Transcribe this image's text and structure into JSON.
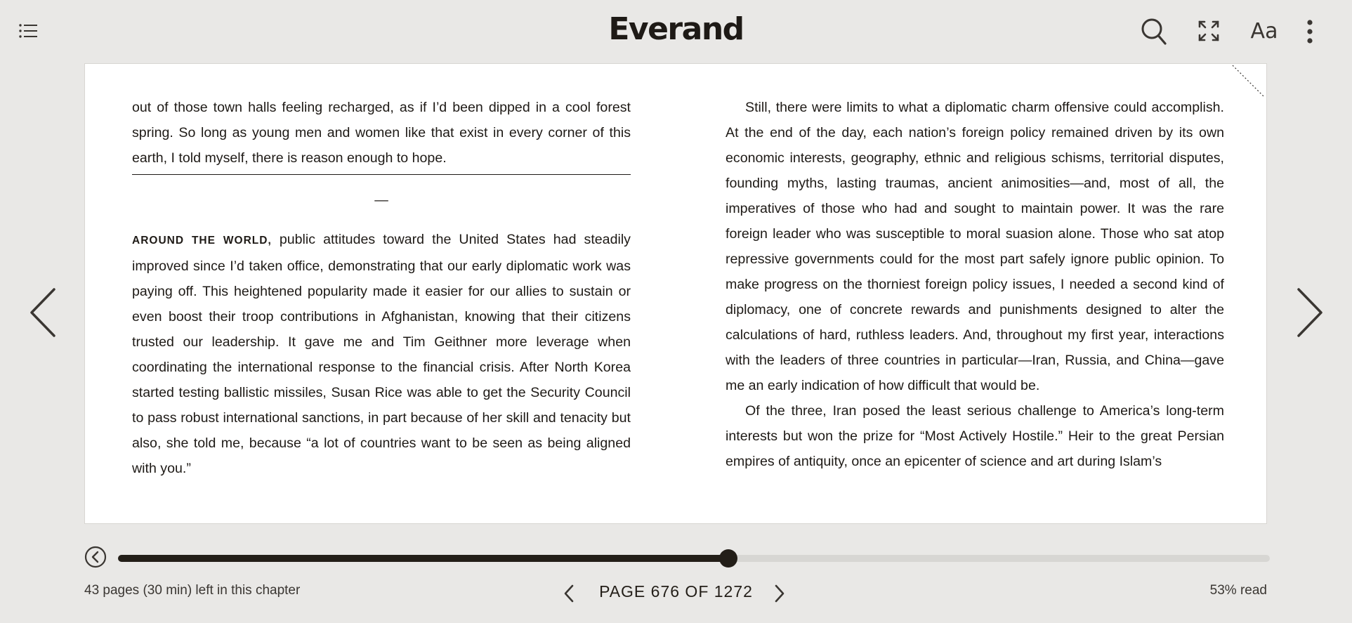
{
  "app": {
    "brand": "Everand"
  },
  "toolbar": {
    "icons": [
      "list-icon",
      "search-icon",
      "fullscreen-icon",
      "font-settings-icon",
      "more-vertical-icon"
    ],
    "font_settings_label": "Aa"
  },
  "left_page": {
    "para1": "out of those town halls feeling recharged, as if I’d been dipped in a cool forest spring. So long as young men and women like that exist in every corner of this earth, I told myself, there is reason enough to hope.",
    "separator": "—",
    "para2_lead": "AROUND THE WORLD,",
    "para2_body": " public attitudes toward the United States had steadily improved since I’d taken office, demonstrating that our early diplomatic work was paying off. This heightened popularity made it easier for our allies to sustain or even boost their troop contributions in Afghanistan, knowing that their citizens trusted our leadership. It gave me and Tim Geithner more leverage when coordinating the international response to the financial crisis. After North Korea started testing ballistic missiles, Susan Rice was able to get the Security Council to pass robust international sanctions, in part because of her skill and tenacity but also, she told me, because “a lot of countries want to be seen as being aligned with you.”"
  },
  "right_page": {
    "para1": "Still, there were limits to what a diplomatic charm offensive could accomplish. At the end of the day, each nation’s foreign policy remained driven by its own economic interests, geography, ethnic and religious schisms, territorial disputes, founding myths, lasting traumas, ancient animosities—and, most of all, the imperatives of those who had and sought to maintain power. It was the rare foreign leader who was susceptible to moral suasion alone. Those who sat atop repressive governments could for the most part safely ignore public opinion. To make progress on the thorniest foreign policy issues, I needed a second kind of diplomacy, one of concrete rewards and punishments designed to alter the calculations of hard, ruthless leaders. And, throughout my first year, interactions with the leaders of three countries in particular—Iran, Russia, and China—gave me an early indication of how difficult that would be.",
    "para2": "Of the three, Iran posed the least serious challenge to America’s long-term interests but won the prize for “Most Actively Hostile.” Heir to the great Persian empires of antiquity, once an epicenter of science and art during Islam’s"
  },
  "navigation": {
    "prev_icon": "chevron-left-icon",
    "next_icon": "chevron-right-icon"
  },
  "progress": {
    "fraction": 0.53,
    "chapter_remaining": "43 pages (30 min) left in this chapter",
    "page_label": "PAGE 676 OF 1272",
    "read_label": "53% read"
  },
  "colors": {
    "background": "#e9e8e6",
    "page": "#ffffff",
    "accent": "#231e18",
    "track": "#d7d6d3"
  }
}
